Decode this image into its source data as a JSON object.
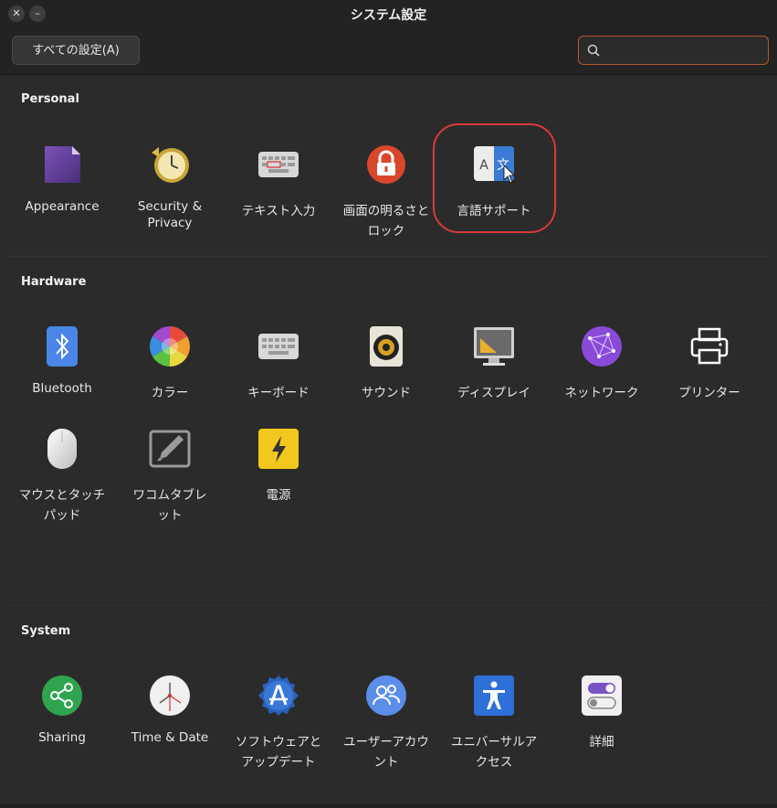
{
  "window": {
    "title": "システム設定"
  },
  "toolbar": {
    "all_settings_label": "すべての設定(A)",
    "search_value": ""
  },
  "sections": {
    "personal": {
      "title": "Personal",
      "items": [
        {
          "label": "Appearance",
          "icon": "appearance-icon"
        },
        {
          "label": "Security & Privacy",
          "icon": "security-privacy-icon"
        },
        {
          "label": "テキスト入力",
          "icon": "keyboard-text-input-icon"
        },
        {
          "label": "画面の明るさとロック",
          "icon": "padlock-icon"
        },
        {
          "label": "言語サポート",
          "icon": "language-support-icon"
        }
      ]
    },
    "hardware": {
      "title": "Hardware",
      "items": [
        {
          "label": "Bluetooth",
          "icon": "bluetooth-icon"
        },
        {
          "label": "カラー",
          "icon": "color-wheel-icon"
        },
        {
          "label": "キーボード",
          "icon": "keyboard-icon"
        },
        {
          "label": "サウンド",
          "icon": "speaker-icon"
        },
        {
          "label": "ディスプレイ",
          "icon": "display-monitor-icon"
        },
        {
          "label": "ネットワーク",
          "icon": "network-globe-icon"
        },
        {
          "label": "プリンター",
          "icon": "printer-icon"
        },
        {
          "label": "マウスとタッチパッド",
          "icon": "mouse-icon"
        },
        {
          "label": "ワコムタブレット",
          "icon": "tablet-pen-icon"
        },
        {
          "label": "電源",
          "icon": "power-bolt-icon"
        }
      ]
    },
    "system": {
      "title": "System",
      "items": [
        {
          "label": "Sharing",
          "icon": "share-icon"
        },
        {
          "label": "Time & Date",
          "icon": "clock-icon"
        },
        {
          "label": "ソフトウェアとアップデート",
          "icon": "software-updates-icon"
        },
        {
          "label": "ユーザーアカウント",
          "icon": "user-accounts-icon"
        },
        {
          "label": "ユニバーサルアクセス",
          "icon": "accessibility-icon"
        },
        {
          "label": "詳細",
          "icon": "toggle-details-icon"
        }
      ]
    }
  },
  "colors": {
    "accent": "#d93a3a",
    "search_border": "#b5562e",
    "background": "#2b2b2b"
  }
}
